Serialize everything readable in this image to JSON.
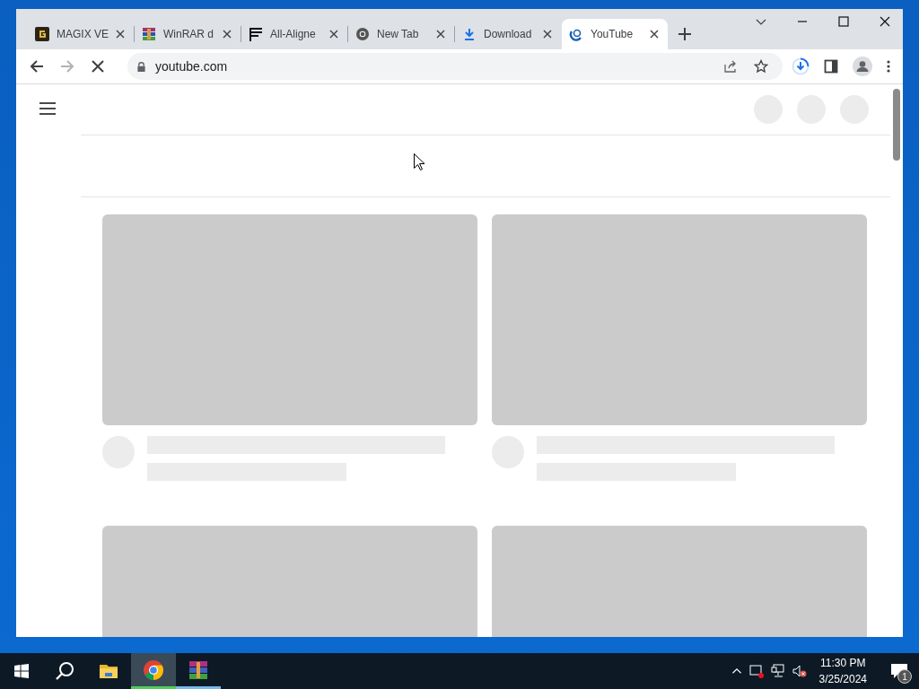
{
  "browser": {
    "tabs": [
      {
        "label": "MAGIX VE",
        "kind": "magix",
        "selected": false
      },
      {
        "label": "WinRAR d",
        "kind": "winrar",
        "selected": false
      },
      {
        "label": "All-Aligne",
        "kind": "flag",
        "selected": false
      },
      {
        "label": "New Tab",
        "kind": "chrome",
        "selected": false
      },
      {
        "label": "Download",
        "kind": "download",
        "selected": false
      },
      {
        "label": "YouTube",
        "kind": "loading",
        "selected": true
      }
    ],
    "address": "youtube.com"
  },
  "taskbar": {
    "apps": [
      {
        "kind": "explorer",
        "selected": false,
        "running": false
      },
      {
        "kind": "chrome",
        "selected": true,
        "running": true
      },
      {
        "kind": "winrar",
        "selected": false,
        "running": true
      }
    ],
    "time": "11:30 PM",
    "date": "3/25/2024",
    "notifications": "1"
  }
}
